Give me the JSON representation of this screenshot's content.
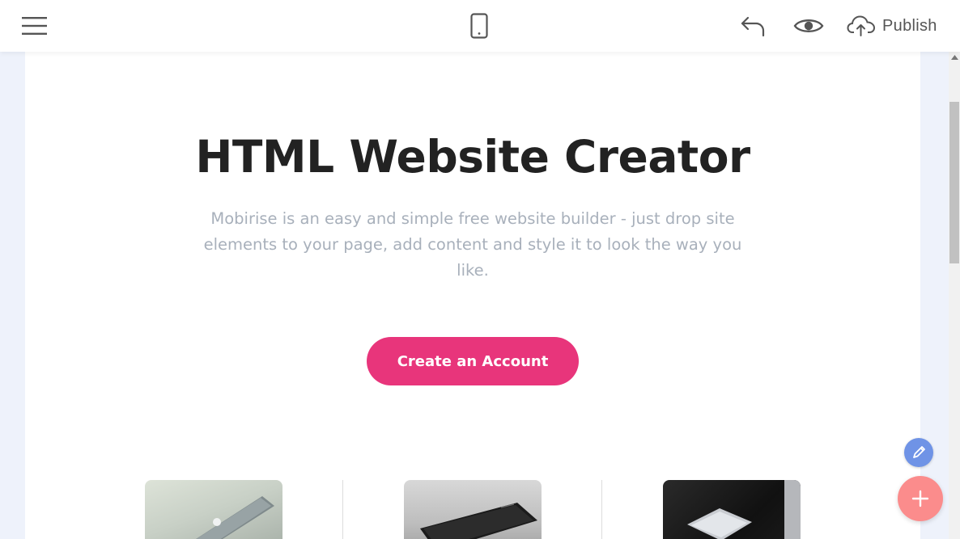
{
  "toolbar": {
    "menu_icon": "hamburger-menu-icon",
    "device_icon": "mobile-phone-icon",
    "undo_icon": "undo-arrow-icon",
    "preview_icon": "eye-icon",
    "publish_icon": "cloud-upload-icon",
    "publish_label": "Publish"
  },
  "hero": {
    "title": "HTML Website Creator",
    "subtitle": "Mobirise is an easy and simple free website builder - just drop site elements to your page, add content and style it to look the way you like.",
    "cta_label": "Create an Account"
  },
  "cards": [
    {
      "image": "laptop-photo"
    },
    {
      "image": "smartphone-photo"
    },
    {
      "image": "laptop-dark-photo"
    }
  ],
  "fab": {
    "edit_icon": "pencil-icon",
    "add_icon": "plus-icon"
  },
  "colors": {
    "accent": "#e8357b",
    "edit_fab": "#6f93e6",
    "add_fab": "#fb8c8c",
    "subtitle_text": "#a8b0bb"
  }
}
